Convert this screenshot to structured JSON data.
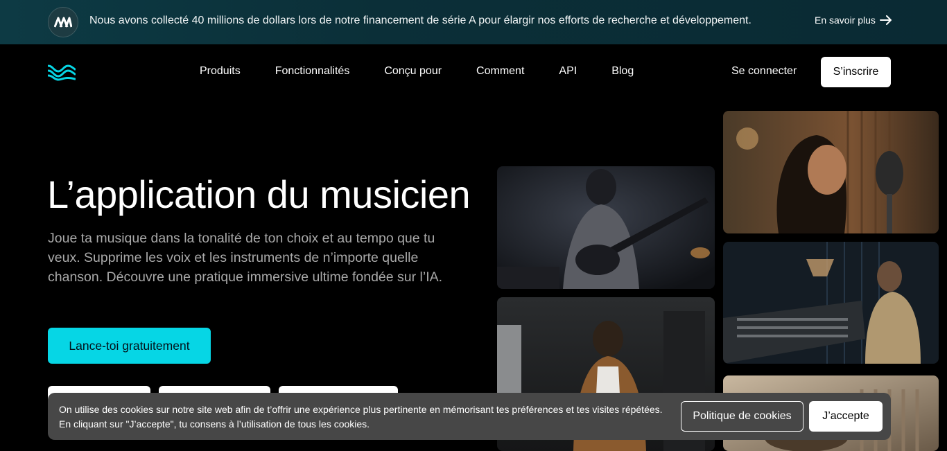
{
  "announcement": {
    "text": "Nous avons collecté 40 millions de dollars lors de notre financement de série A pour élargir nos efforts de recherche et développement.",
    "link_label": "En savoir plus",
    "logo_icon": "moises-m-logo-icon",
    "arrow_icon": "arrow-right-icon"
  },
  "nav": {
    "logo_icon": "waves-logo-icon",
    "links": [
      "Produits",
      "Fonctionnalités",
      "Conçu pour",
      "Comment",
      "API",
      "Blog"
    ],
    "login_label": "Se connecter",
    "signup_label": "S’inscrire"
  },
  "hero": {
    "title": "L’application du musicien",
    "subtitle": "Joue ta musique dans la tonalité de ton choix et au tempo que tu veux. Supprime les voix et les instruments de n’importe quelle chanson. Découvre une pratique immersive ultime fondée sur l’IA.",
    "cta_label": "Lance-toi gratuitement"
  },
  "gallery": {
    "images": [
      "guitarist-photo",
      "singer-microphone-photo",
      "man-studio-photo",
      "pianist-studio-photo",
      "guitar-workshop-photo"
    ]
  },
  "cookie": {
    "line1": "On utilise des cookies sur notre site web afin de t’offrir une expérience plus pertinente en mémorisant tes préférences et tes visites répétées.",
    "line2": "En cliquant sur \"J’accepte\", tu consens à l’utilisation de tous les cookies.",
    "policy_label": "Politique de cookies",
    "accept_label": "J’accepte"
  },
  "colors": {
    "accent": "#06d6e5",
    "background": "#000000",
    "announcement_bg": "#0b2f38",
    "cookie_bg": "#474747"
  }
}
